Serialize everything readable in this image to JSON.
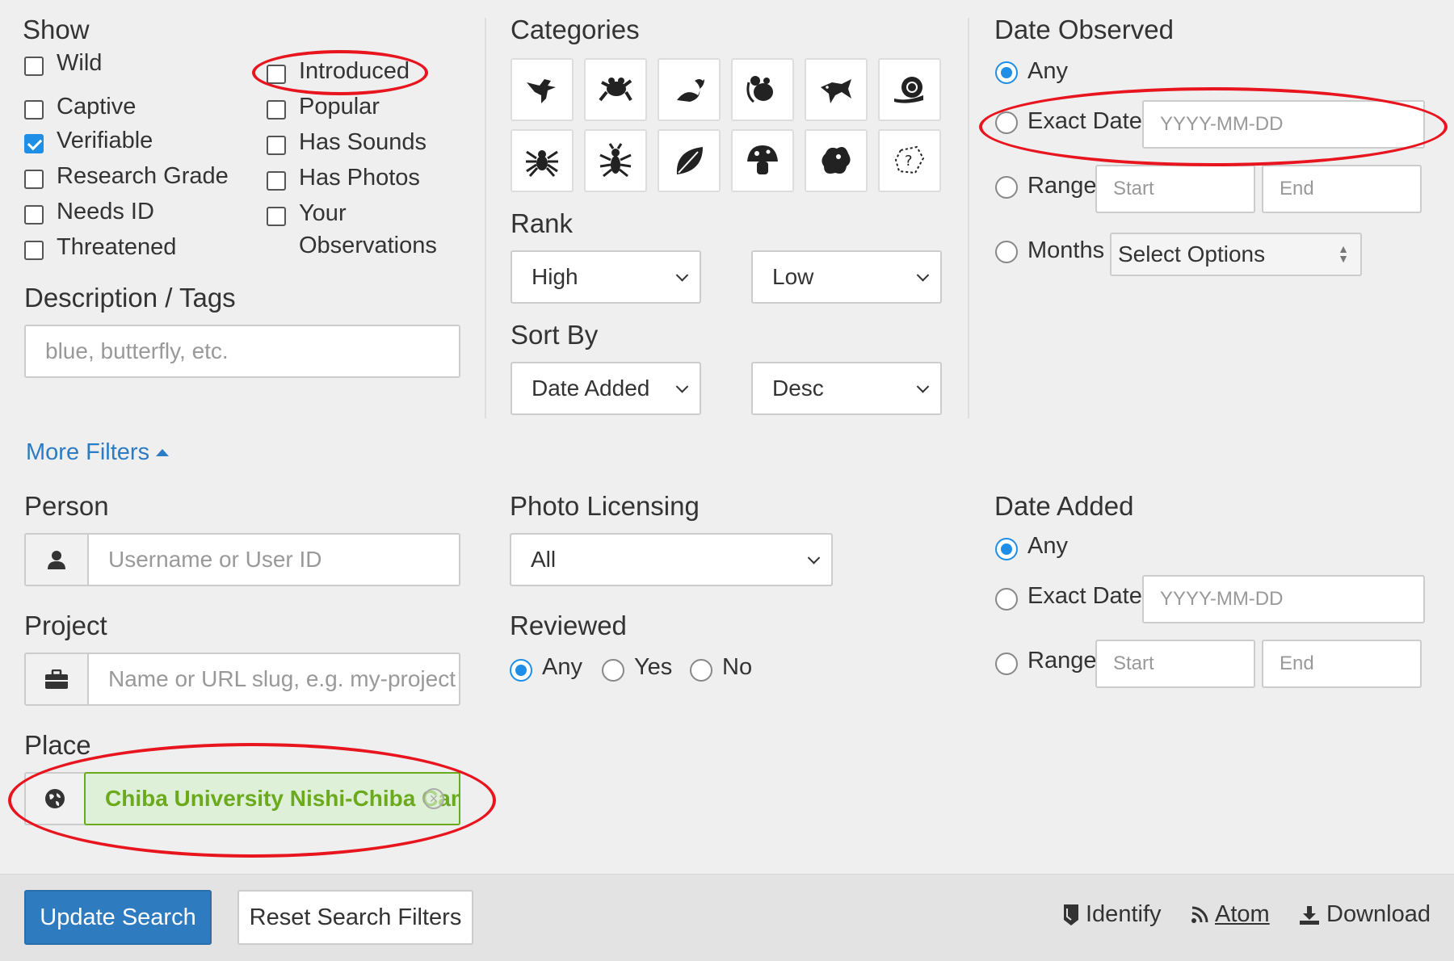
{
  "show": {
    "heading": "Show",
    "left": [
      {
        "label": "Wild",
        "checked": false
      },
      {
        "label": "Captive",
        "checked": false
      },
      {
        "label": "Verifiable",
        "checked": true
      },
      {
        "label": "Research Grade",
        "checked": false
      },
      {
        "label": "Needs ID",
        "checked": false
      },
      {
        "label": "Threatened",
        "checked": false
      }
    ],
    "right": [
      {
        "label": "Introduced",
        "checked": false
      },
      {
        "label": "Popular",
        "checked": false
      },
      {
        "label": "Has Sounds",
        "checked": false
      },
      {
        "label": "Has Photos",
        "checked": false
      },
      {
        "label": "Your",
        "label2": "Observations",
        "checked": false
      }
    ]
  },
  "description": {
    "heading": "Description / Tags",
    "placeholder": "blue, butterfly, etc."
  },
  "categories": {
    "heading": "Categories",
    "icons": [
      "bird-icon",
      "amphibian-icon",
      "reptile-icon",
      "mammal-icon",
      "fish-icon",
      "mollusk-icon",
      "arachnid-icon",
      "insect-icon",
      "plant-icon",
      "fungi-icon",
      "protozoa-icon",
      "unknown-icon"
    ]
  },
  "rank": {
    "heading": "Rank",
    "high": "High",
    "low": "Low"
  },
  "sort": {
    "heading": "Sort By",
    "field": "Date Added",
    "order": "Desc"
  },
  "date_observed": {
    "heading": "Date Observed",
    "any": "Any",
    "exact": "Exact Date",
    "exact_placeholder": "YYYY-MM-DD",
    "range": "Range",
    "start": "Start",
    "end": "End",
    "months": "Months",
    "months_select": "Select Options",
    "selected": "Any"
  },
  "more_filters": {
    "label": "More Filters"
  },
  "person": {
    "heading": "Person",
    "placeholder": "Username or User ID"
  },
  "project": {
    "heading": "Project",
    "placeholder": "Name or URL slug, e.g. my-project"
  },
  "place": {
    "heading": "Place",
    "value": "Chiba University Nishi-Chiba Campus"
  },
  "photo_licensing": {
    "heading": "Photo Licensing",
    "value": "All"
  },
  "reviewed": {
    "heading": "Reviewed",
    "options": [
      "Any",
      "Yes",
      "No"
    ],
    "selected": "Any"
  },
  "date_added": {
    "heading": "Date Added",
    "any": "Any",
    "exact": "Exact Date",
    "exact_placeholder": "YYYY-MM-DD",
    "range": "Range",
    "start": "Start",
    "end": "End",
    "selected": "Any"
  },
  "footer": {
    "update": "Update Search",
    "reset": "Reset Search Filters",
    "identify": "Identify",
    "atom": "Atom",
    "download": "Download"
  },
  "colors": {
    "accent": "#1e8ee6",
    "primary_button": "#2f7bbf",
    "place_green": "#6aaa1c",
    "annotation": "#e8141e"
  }
}
